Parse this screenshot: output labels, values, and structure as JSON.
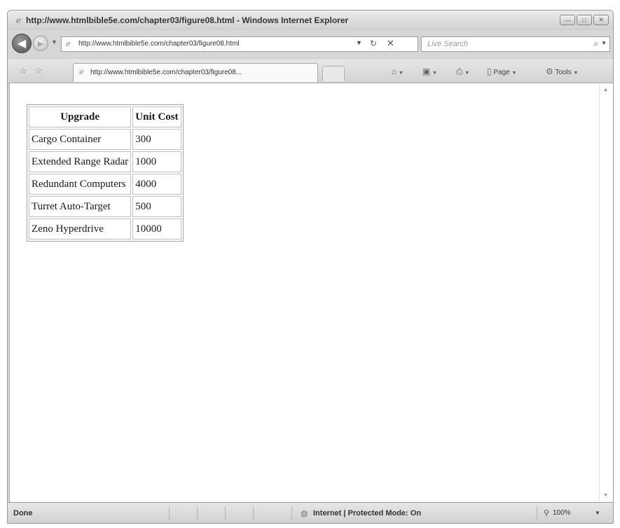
{
  "window": {
    "title": "http://www.htmlbible5e.com/chapter03/figure08.html - Windows Internet Explorer",
    "buttons": {
      "minimize": "—",
      "maximize": "□",
      "close": "✕"
    }
  },
  "nav": {
    "address": "http://www.htmlbible5e.com/chapter03/figure08.html",
    "search_placeholder": "Live Search"
  },
  "tabs": [
    {
      "label": "http://www.htmlbible5e.com/chapter03/figure08..."
    }
  ],
  "commandbar": {
    "page_label": "Page",
    "tools_label": "Tools"
  },
  "page": {
    "table": {
      "headers": [
        "Upgrade",
        "Unit Cost"
      ],
      "rows": [
        [
          "Cargo Container",
          "300"
        ],
        [
          "Extended Range Radar",
          "1000"
        ],
        [
          "Redundant Computers",
          "4000"
        ],
        [
          "Turret Auto-Target",
          "500"
        ],
        [
          "Zeno Hyperdrive",
          "10000"
        ]
      ]
    }
  },
  "statusbar": {
    "status": "Done",
    "zone": "Internet | Protected Mode: On",
    "zoom": "100%"
  },
  "icons": {
    "back": "back-arrow-icon",
    "forward": "forward-arrow-icon",
    "refresh": "refresh-icon",
    "stop": "stop-icon",
    "search": "search-icon",
    "favorites": "favorites-star-icon",
    "add_favorites": "add-favorites-icon",
    "home": "home-icon",
    "feeds": "feeds-icon",
    "print": "print-icon",
    "page": "page-icon",
    "tools": "tools-gear-icon",
    "globe": "globe-icon",
    "zoom": "zoom-icon"
  }
}
